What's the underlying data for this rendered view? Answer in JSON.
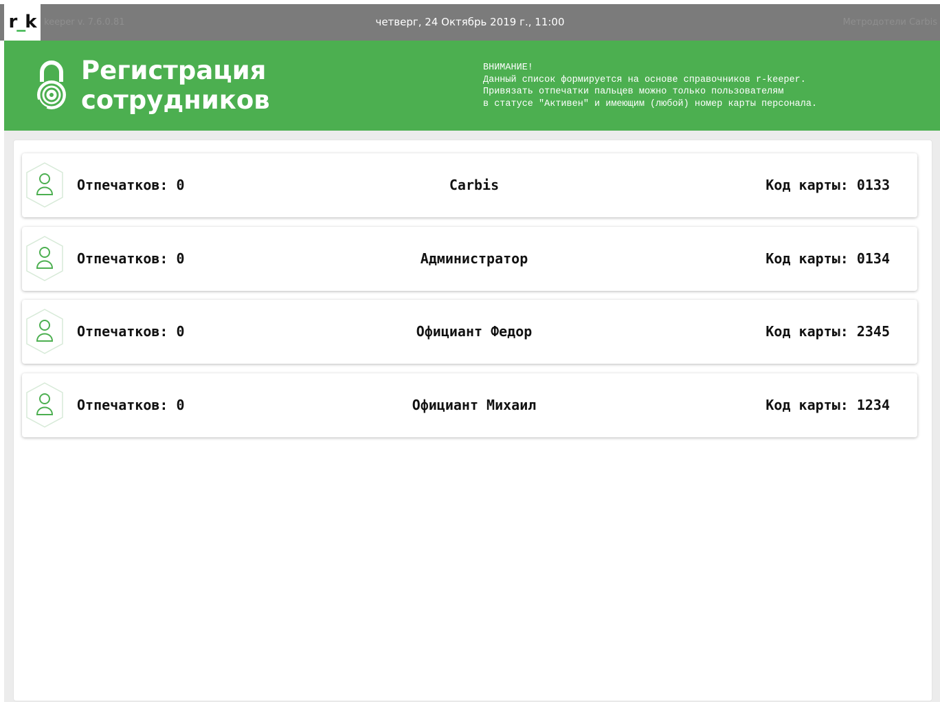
{
  "topbar": {
    "logo_main": "r",
    "logo_underscore": "_",
    "logo_tail": "k",
    "version": "keeper v. 7.6.0.81",
    "datetime": "четверг, 24 Октябрь 2019 г., 11:00",
    "company": "Метродотели Carbis"
  },
  "header": {
    "title_line1": "Регистрация",
    "title_line2": "сотрудников",
    "notice": "ВНИМАНИЕ!\nДанный список формируется на основе справочников r-keeper.\nПривязать отпечатки пальцев можно только пользователям\nв статусе \"Активен\" и имеющим (любой) номер карты персонала.",
    "icon": "fingerprint-lock-icon",
    "color": "#4caf50"
  },
  "employees": [
    {
      "prints": "Отпечатков: 0",
      "name": "Carbis",
      "card": "Код карты: 0133",
      "icon": "user-icon"
    },
    {
      "prints": "Отпечатков: 0",
      "name": "Администратор",
      "card": "Код карты: 0134",
      "icon": "user-icon"
    },
    {
      "prints": "Отпечатков: 0",
      "name": "Официант Федор",
      "card": "Код карты: 2345",
      "icon": "user-icon"
    },
    {
      "prints": "Отпечатков: 0",
      "name": "Официант Михаил",
      "card": "Код карты: 1234",
      "icon": "user-icon"
    }
  ]
}
